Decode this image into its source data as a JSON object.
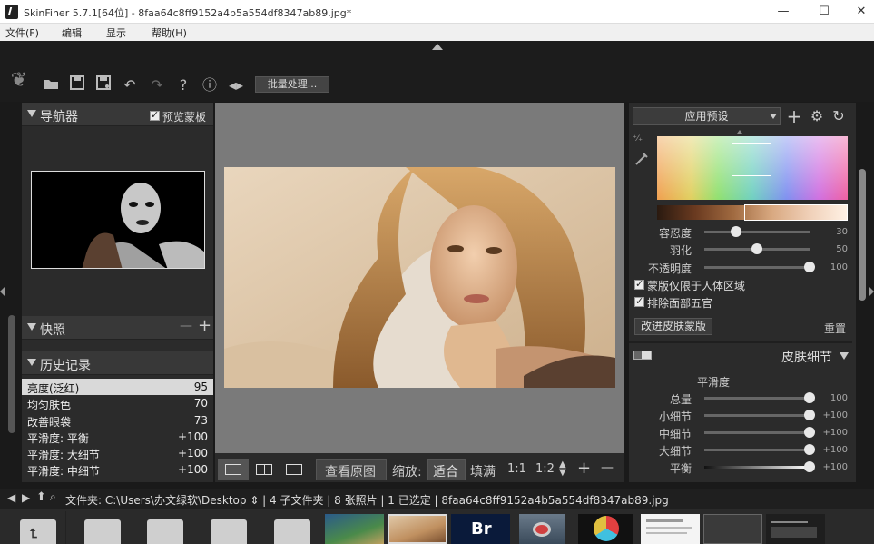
{
  "window": {
    "title": "SkinFiner 5.7.1[64位] - 8faa64c8ff9152a4b5a554df8347ab89.jpg*",
    "min_glyph": "—",
    "max_glyph": "☐",
    "close_glyph": "✕"
  },
  "menu": [
    "文件(F)",
    "编辑",
    "显示",
    "帮助(H)"
  ],
  "toolbar": {
    "batch_label": "批量处理..."
  },
  "navigator": {
    "title": "导航器",
    "preview_mask_label": "预览蒙板",
    "preview_mask_checked": true
  },
  "snapshots": {
    "title": "快照",
    "minus": "—",
    "plus": "+"
  },
  "history": {
    "title": "历史记录",
    "items": [
      {
        "label": "亮度(泛红)",
        "value": "95",
        "selected": true
      },
      {
        "label": "均匀肤色",
        "value": "70"
      },
      {
        "label": "改善眼袋",
        "value": "73"
      },
      {
        "label": "平滑度: 平衡",
        "value": "+100"
      },
      {
        "label": "平滑度: 大细节",
        "value": "+100"
      },
      {
        "label": "平滑度: 中细节",
        "value": "+100"
      }
    ]
  },
  "view_bar": {
    "view_original": "查看原图",
    "zoom_label": "缩放:",
    "fit": "适合",
    "fill": "填满",
    "one_to_one": "1:1",
    "one_to_two": "1:2",
    "plus": "+",
    "minus": "—"
  },
  "right_panel": {
    "preset_label": "应用预设",
    "mask_sliders": [
      {
        "label": "容忍度",
        "value": 30
      },
      {
        "label": "羽化",
        "value": 50
      },
      {
        "label": "不透明度",
        "value": 100
      }
    ],
    "limit_body_label": "蒙版仅限于人体区域",
    "limit_body_checked": true,
    "exclude_face_label": "排除面部五官",
    "exclude_face_checked": true,
    "improve_mask_btn": "改进皮肤蒙版",
    "reset_label": "重置",
    "skin_detail_title": "皮肤细节",
    "smoothness_title": "平滑度",
    "detail_sliders": [
      {
        "label": "总量",
        "value": "100",
        "level": 1.0
      },
      {
        "label": "小细节",
        "value": "+100",
        "level": 1.0
      },
      {
        "label": "中细节",
        "value": "+100",
        "level": 1.0
      },
      {
        "label": "大细节",
        "value": "+100",
        "level": 1.0
      },
      {
        "label": "平衡",
        "value": "+100",
        "level": 1.0
      }
    ]
  },
  "path_bar": {
    "text": "文件夹:  C:\\Users\\办文绿软\\Desktop ⇕ | 4 子文件夹 | 8 张照片 | 1 已选定 | 8faa64c8ff9152a4b5a554df8347ab89.jpg"
  },
  "filmstrip": {
    "br_label": "Br"
  }
}
